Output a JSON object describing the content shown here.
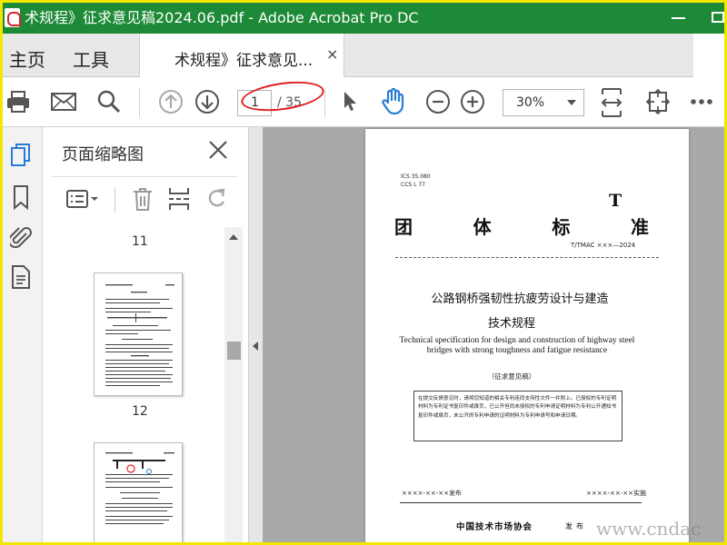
{
  "window": {
    "watermark": "",
    "title": "术规程》征求意见稿2024.06.pdf - Adobe Acrobat Pro DC"
  },
  "menu": {
    "home": "主页",
    "tools": "工具"
  },
  "tab": {
    "label": "术规程》征求意见...",
    "close": "×"
  },
  "toolbar": {
    "page_current": "1",
    "page_total": "/ 35",
    "zoom": "30%"
  },
  "thumbnails": {
    "title": "页面缩略图",
    "pages": [
      "11",
      "12"
    ]
  },
  "document": {
    "ics": "ICS 35.080",
    "ccs": "CCS L 77",
    "big_t": "T",
    "heading_chars": [
      "团",
      "体",
      "标",
      "准"
    ],
    "standard_number": "T/TMAC ×××—2024",
    "title_zh_line1": "公路钢桥强韧性抗疲劳设计与建造",
    "title_zh_line2": "技术规程",
    "title_en": "Technical specification for design and construction of highway steel bridges with strong toughness and fatigue resistance",
    "draft_label": "（征求意见稿）",
    "notice": "在提交反馈意见时，请将您知道的相关专利连同支持性文件一并附上。已授权的专利证明材料为专利证书复印件或扉页，已公开但尚未授权的专利申请证明材料为专利公开通知书复印件或扉页，未公开的专利申请的证明材料为专利申请号和申请日期。",
    "release_date": "××××-××-××发布",
    "implement_date": "××××-××-××实施",
    "organization": "中国技术市场协会",
    "publish": "发布"
  },
  "site_watermark": "www.cndac",
  "colors": {
    "titlebar": "#1c8a36",
    "border": "#f3e600",
    "annotation": "#e02020",
    "accent_icon": "#2a7bd4"
  }
}
